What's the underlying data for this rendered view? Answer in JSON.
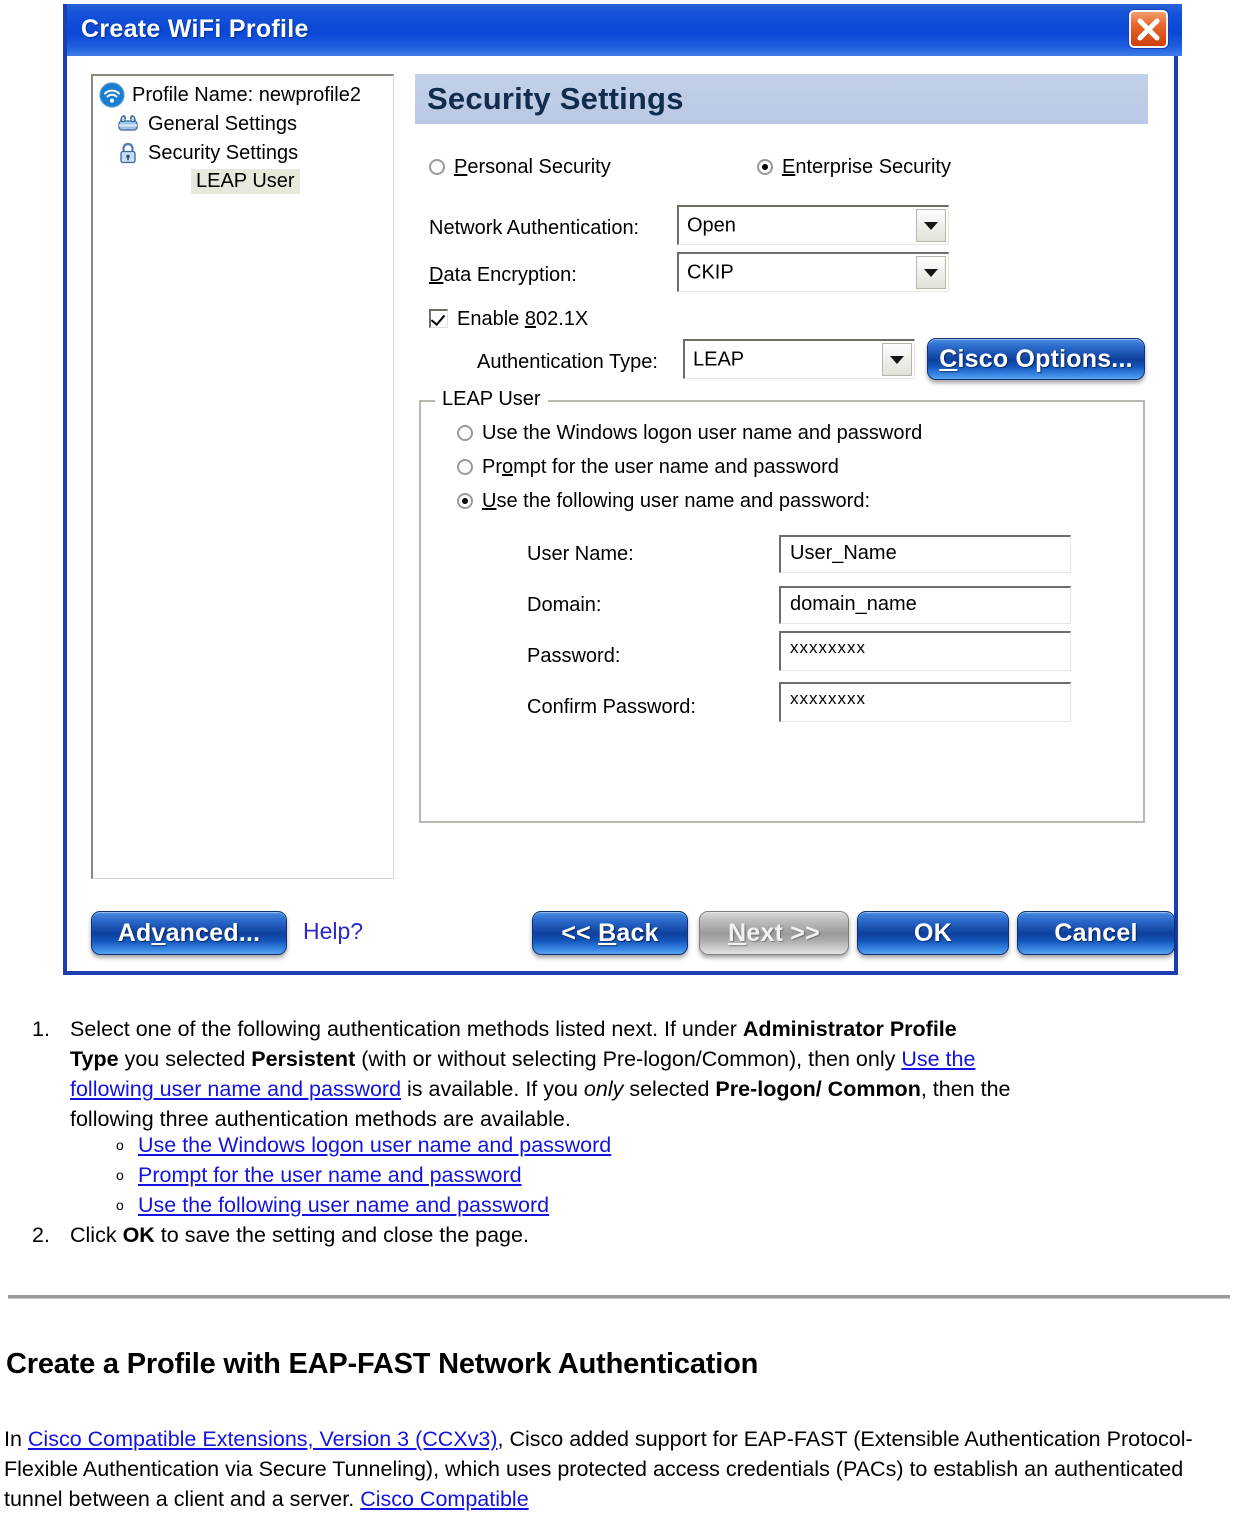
{
  "dialog": {
    "title": "Create WiFi Profile",
    "close_icon": "close-icon",
    "tree": {
      "items": [
        {
          "label": "Profile Name: newprofile2",
          "icon": "wifi-icon",
          "selected": false
        },
        {
          "label": "General Settings",
          "icon": "settings-icon",
          "selected": false
        },
        {
          "label": "Security Settings",
          "icon": "lock-icon",
          "selected": false
        },
        {
          "label": "LEAP User",
          "icon": "none",
          "selected": true
        }
      ]
    },
    "page_title": "Security Settings",
    "security_mode": {
      "personal_label": "Personal Security",
      "personal_selected": false,
      "enterprise_label": "Enterprise Security",
      "enterprise_selected": true
    },
    "fields": {
      "network_auth_label": "Network Authentication:",
      "network_auth_value": "Open",
      "data_encryption_label": "Data Encryption:",
      "data_encryption_value": "CKIP",
      "enable_8021x_label": "Enable 802.1X",
      "enable_8021x_checked": true,
      "auth_type_label": "Authentication Type:",
      "auth_type_value": "LEAP",
      "cisco_options_label": "Cisco Options..."
    },
    "leap_user": {
      "group_title": "LEAP User",
      "options": [
        {
          "label": "Use the Windows logon user name and password",
          "selected": false
        },
        {
          "label": "Prompt for the user name and password",
          "selected": false
        },
        {
          "label": "Use the following user name and password:",
          "selected": true
        }
      ],
      "inputs": [
        {
          "label": "User Name:",
          "value": "User_Name",
          "masked": false
        },
        {
          "label": "Domain:",
          "value": "domain_name",
          "masked": false
        },
        {
          "label": "Password:",
          "value": "xxxxxxxx",
          "masked": true
        },
        {
          "label": "Confirm Password:",
          "value": "xxxxxxxx",
          "masked": true
        }
      ]
    },
    "footer": {
      "advanced_label": "Advanced...",
      "help_label": "Help?",
      "back_label": "<< Back",
      "next_label": "Next >>",
      "ok_label": "OK",
      "cancel_label": "Cancel"
    }
  },
  "doc": {
    "step1": {
      "number": "1.",
      "l1_a": "Select one of the following authentication methods listed next. If under ",
      "l1_b": "Administrator Profile",
      "l2_a": "Type",
      "l2_b": " you selected ",
      "l2_c": "Persistent",
      "l2_d": " (with or without selecting Pre-logon/Common), then only ",
      "l2_link": "Use the",
      "l3_link": "following user name and password",
      "l3_a": " is available. If you ",
      "l3_it": "only",
      "l3_b": " selected ",
      "l3_c": "Pre-logon/ Common",
      "l3_d": ", then the",
      "l4": "following three authentication methods are available."
    },
    "sub_links": [
      "Use the Windows logon user name and password",
      "Prompt for the user name and password",
      "Use the following user name and password"
    ],
    "bullet_glyph": "o",
    "step2": {
      "number": "2.",
      "a": "Click ",
      "b": "OK",
      "c": " to save the setting and close the page."
    },
    "section_heading": "Create a Profile with EAP-FAST Network Authentication",
    "paragraph": {
      "p_a": "In ",
      "p_link1": "Cisco Compatible Extensions, Version 3 (CCXv3)",
      "p_b": ", Cisco added support for EAP-FAST (Extensible Authentication Protocol-Flexible Authentication via Secure Tunneling), which uses protected access credentials (PACs) to establish an authenticated tunnel between a client and a server. ",
      "p_link2": "Cisco Compatible"
    }
  },
  "colors": {
    "title_blue": "#0a48d6",
    "dialog_border": "#1b3fb0",
    "header_band": "#bcc9e5",
    "link_blue": "#1414e0",
    "close_red": "#cf3f0e"
  }
}
